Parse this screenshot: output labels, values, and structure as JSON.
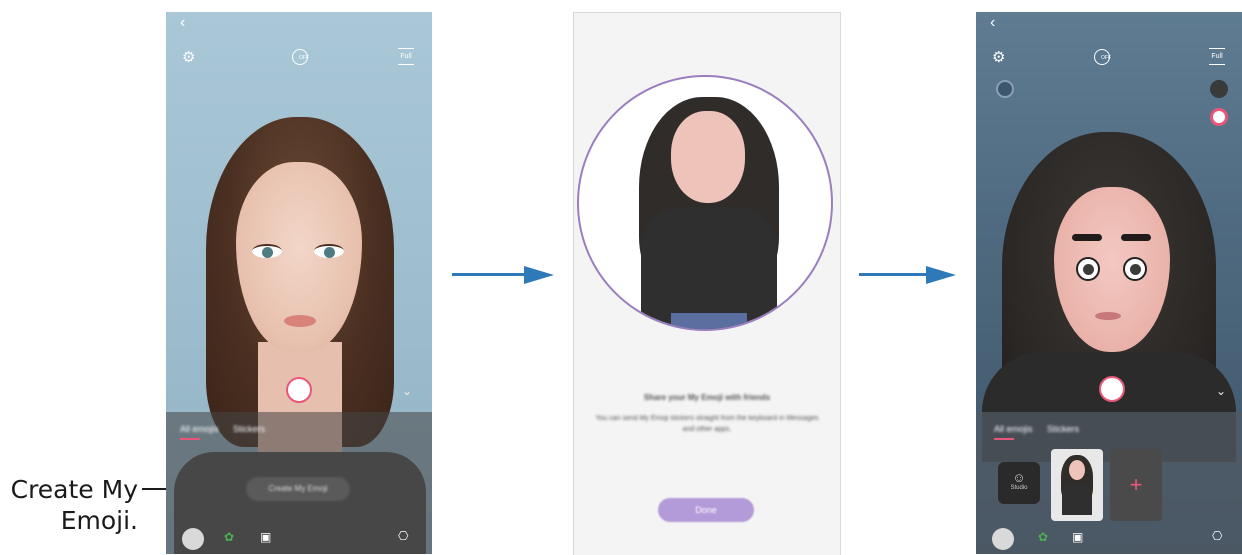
{
  "callout": {
    "text": "Create My Emoji."
  },
  "screen1": {
    "back": "‹",
    "gear": "⚙",
    "timer": "OFF",
    "full": "Full",
    "tabs": [
      "All emojis",
      "Stickers"
    ],
    "create_button": "Create My Emoji",
    "chevron": "⌄"
  },
  "screen2": {
    "title": "Share your My Emoji with friends",
    "body": "You can send My Emoji stickers straight from the keyboard in Messages and other apps.",
    "done": "Done"
  },
  "screen3": {
    "back": "‹",
    "gear": "⚙",
    "timer": "OFF",
    "full": "Full",
    "tabs": [
      "All emojis",
      "Stickers"
    ],
    "studio": "Studio",
    "add": "+",
    "chevron": "⌄"
  },
  "colors": {
    "accent_pink": "#e8577a",
    "arrow_blue": "#2e7ab8",
    "done_purple": "#b39ad8"
  },
  "icons": [
    "back-icon",
    "settings-icon",
    "timer-icon",
    "full-icon",
    "avatar-icon",
    "stickers-icon",
    "gallery-icon",
    "bag-icon",
    "plus-icon",
    "studio-icon"
  ]
}
